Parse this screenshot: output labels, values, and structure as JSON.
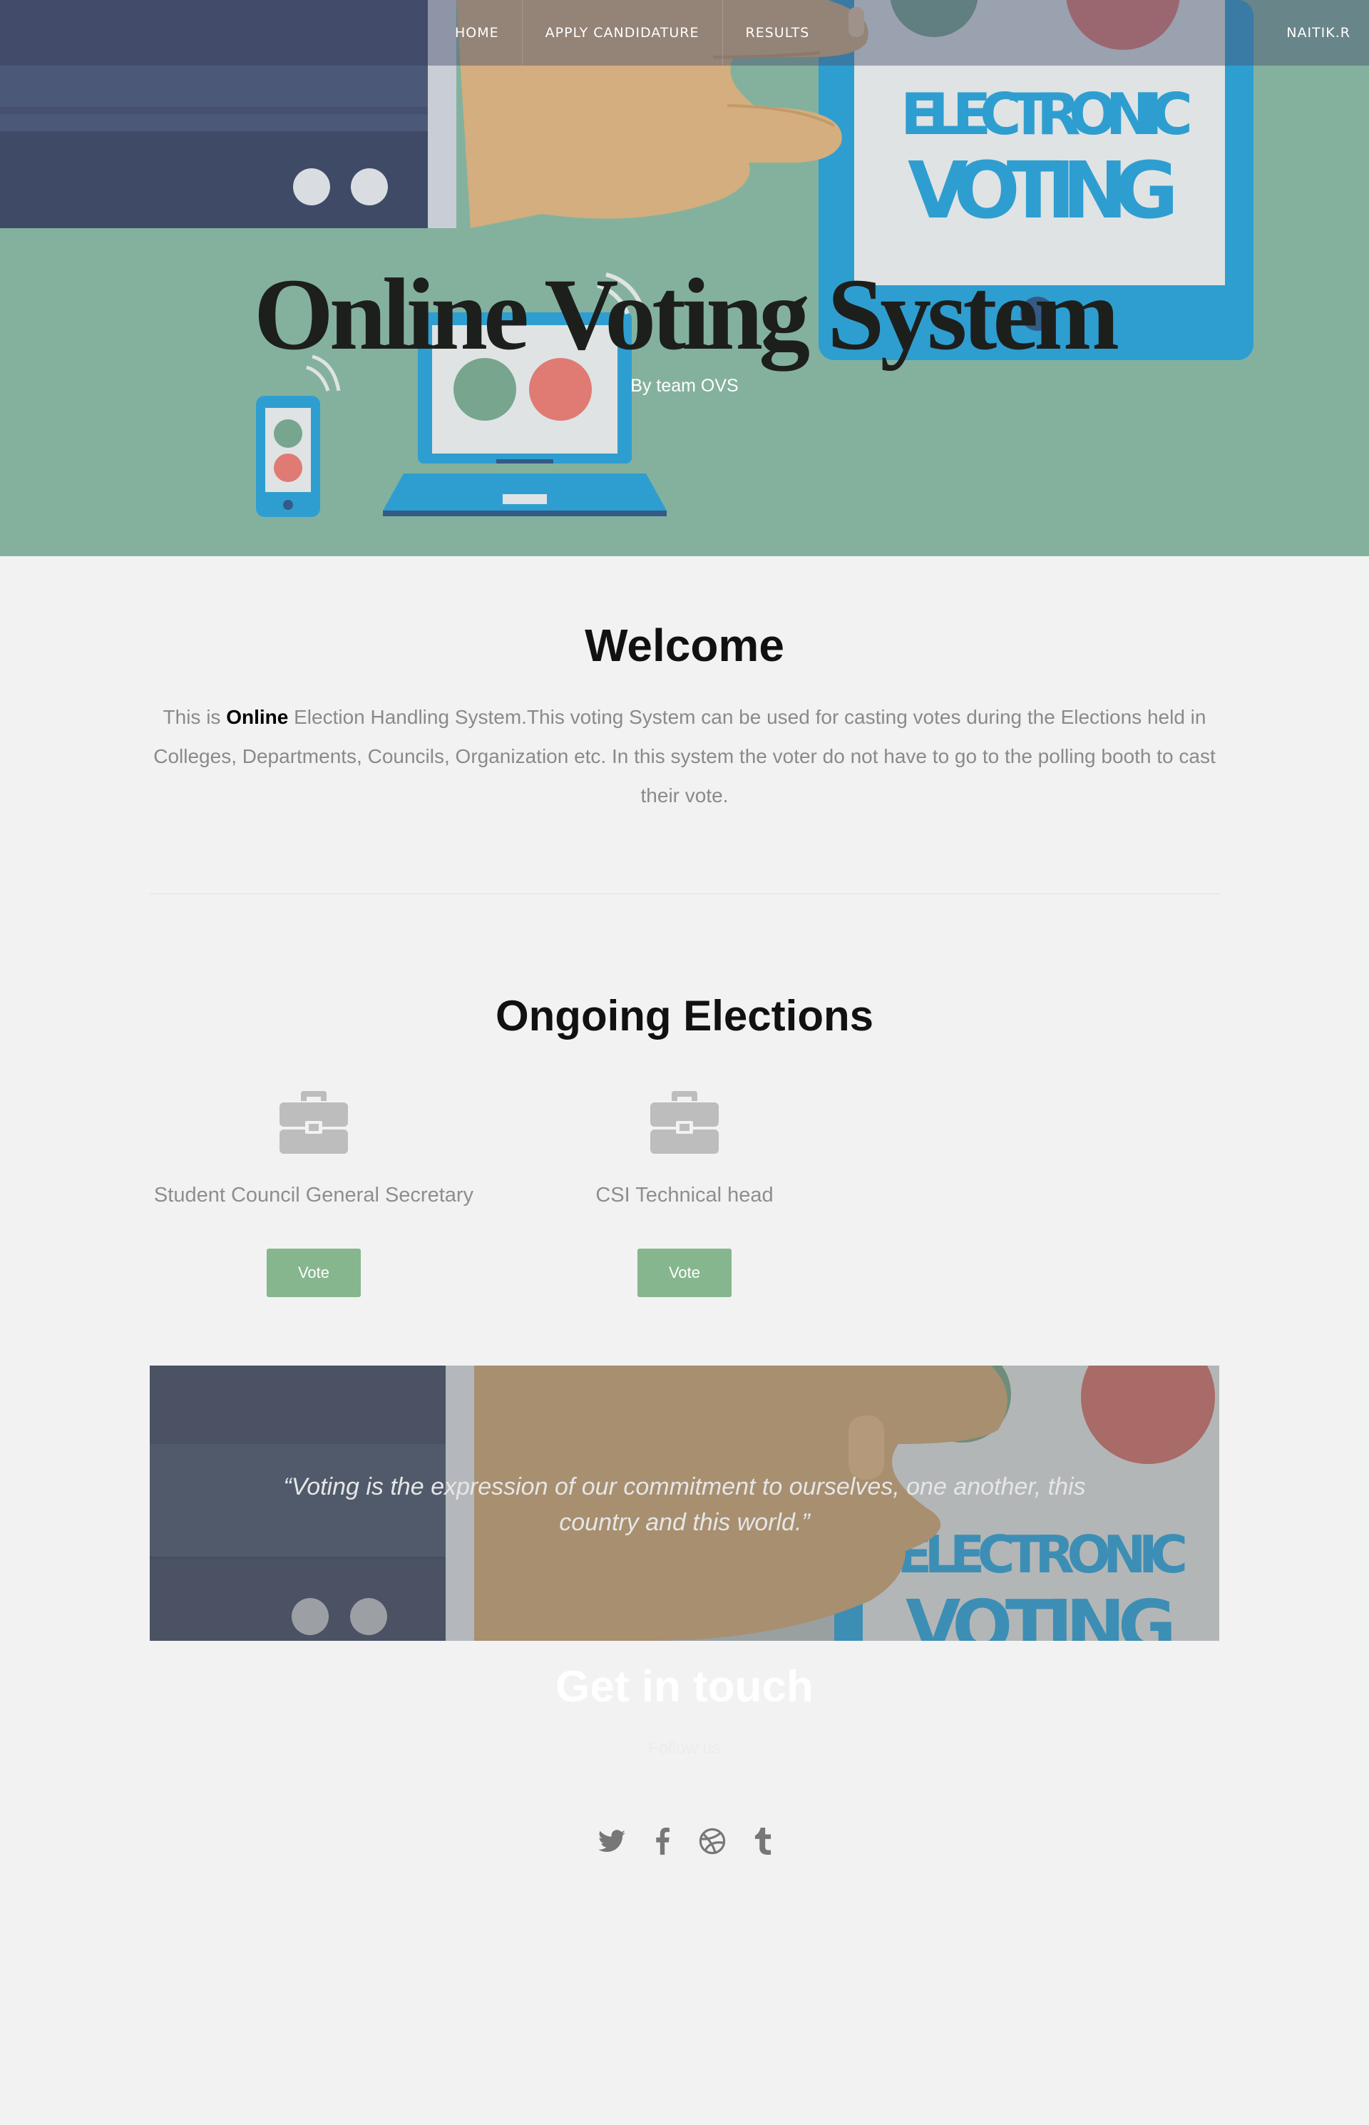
{
  "nav": {
    "items": [
      "HOME",
      "APPLY CANDIDATURE",
      "RESULTS"
    ],
    "user": "NAITIK.R"
  },
  "hero": {
    "title": "Online Voting System",
    "subtitle": "By team OVS",
    "art_text_1": "ELECTRONIC",
    "art_text_2": "VOTING"
  },
  "welcome": {
    "title": "Welcome",
    "text_before": "This is ",
    "text_bold": "Online",
    "text_after": " Election Handling System.This voting System can be used for casting votes during the Elections held in Colleges, Departments, Councils, Organization etc. In this system the voter do not have to go to the polling booth to cast their vote."
  },
  "elections": {
    "title": "Ongoing Elections",
    "items": [
      {
        "name": "Student Council General Secretary",
        "button": "Vote",
        "icon": "briefcase-icon"
      },
      {
        "name": "CSI Technical head",
        "button": "Vote",
        "icon": "briefcase-icon"
      }
    ]
  },
  "quote": {
    "text": "“Voting is the expression of our commitment to ourselves, one another, this country and this world.”",
    "art_text_1": "ELECTRONIC",
    "art_text_2": "VOTING"
  },
  "contact": {
    "title": "Get in touch",
    "subtitle": "Follow us",
    "icons": [
      "twitter-icon",
      "facebook-icon",
      "dribbble-icon",
      "tumblr-icon"
    ]
  },
  "colors": {
    "hero_bg": "#84b19e",
    "accent_green": "#86b68d",
    "page_bg": "#f2f2f2",
    "nav_overlay": "#46506e"
  }
}
